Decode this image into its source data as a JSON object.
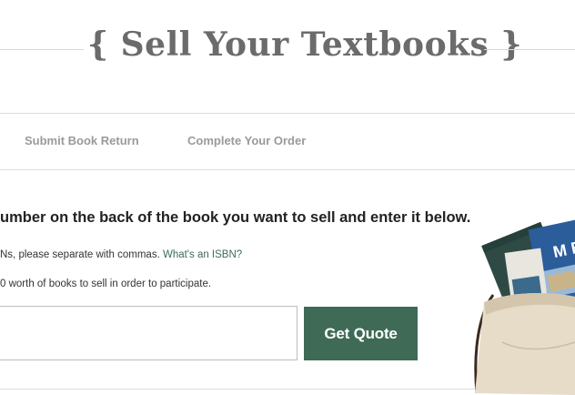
{
  "header": {
    "title": "{ Sell Your Textbooks }"
  },
  "steps": [
    {
      "label": "Submit Book Return"
    },
    {
      "label": "Complete Your Order"
    }
  ],
  "main": {
    "instruction": "umber on the back of the book you want to sell and enter it below.",
    "hint_text": "Ns, please separate with commas. ",
    "hint_link": "What's an ISBN?",
    "minimum_text": "0 worth of books to sell in order to participate.",
    "isbn_input": {
      "value": "",
      "placeholder": ""
    },
    "quote_button": "Get Quote"
  },
  "illustration": {
    "icon": "tote-bag-with-books-icon",
    "book_cover_text": "M EU"
  },
  "colors": {
    "accent": "#3f6b56",
    "link": "#3a6b5a",
    "title": "#6b6b6b",
    "step_text": "#9a9a9a"
  }
}
